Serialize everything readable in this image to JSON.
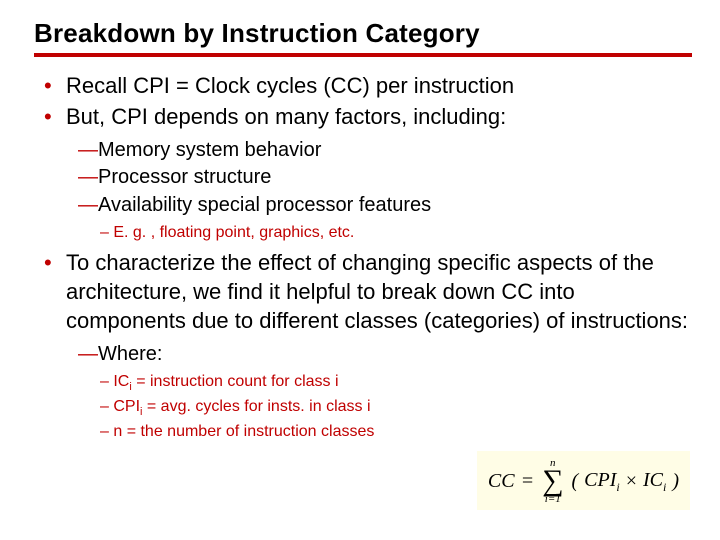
{
  "title": "Breakdown by Instruction Category",
  "bullets": {
    "b1": "Recall CPI = Clock cycles (CC) per instruction",
    "b2": "But, CPI depends on many factors, including:",
    "b2_sub": {
      "s1": "Memory system behavior",
      "s2": "Processor structure",
      "s3": "Availability special processor features",
      "s3_eg": "E. g. , floating point, graphics, etc."
    },
    "b3": "To characterize the effect of changing specific aspects of the architecture, we find it helpful to break down CC into components due to different classes (categories) of instructions:",
    "b3_sub": {
      "where": "Where:",
      "d1_pre": "IC",
      "d1_sub": "i",
      "d1_post": " = instruction count for class i",
      "d2_pre": "CPI",
      "d2_sub": "i",
      "d2_post": " = avg. cycles for insts. in class i",
      "d3": "n = the number of instruction classes"
    }
  },
  "formula": {
    "lhs": "CC",
    "eq": "=",
    "sum_top": "n",
    "sum_bottom": "i=1",
    "open": "(",
    "t1": "CPI",
    "t1_sub": "i",
    "times": "×",
    "t2": "IC",
    "t2_sub": "i",
    "close": ")"
  },
  "glyphs": {
    "mdash": "—",
    "endash": "– ",
    "sigma": "∑"
  }
}
